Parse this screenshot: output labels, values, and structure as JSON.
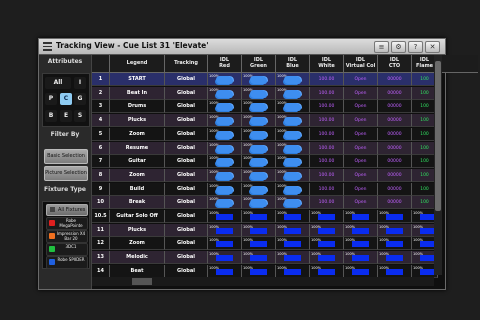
{
  "window": {
    "title": "Tracking View - Cue List 31 'Elevate'"
  },
  "titlebar_buttons": [
    "≡",
    "⚙",
    "?",
    "✕"
  ],
  "sidebar": {
    "attributes_label": "Attributes",
    "attr_buttons": [
      "All",
      "I",
      "P",
      "C",
      "G",
      "B",
      "E",
      "S"
    ],
    "selected_attr": "C",
    "filter_label": "Filter By",
    "filter_buttons": [
      "Basic Selection",
      "Picture Selection"
    ],
    "fixture_type_label": "Fixture Type",
    "all_fixtures_label": "All Fixtures",
    "fixtures": [
      {
        "name": "Robe MegaPointe",
        "color": "#e02020"
      },
      {
        "name": "Impression X4 Bar 20",
        "color": "#f07020"
      },
      {
        "name": "3DC1",
        "color": "#20c040"
      },
      {
        "name": "Robe SPIIDER",
        "color": "#2060e0"
      }
    ]
  },
  "columns": [
    {
      "label": ""
    },
    {
      "label": "Legend"
    },
    {
      "label": "Tracking"
    },
    {
      "label": "IDL\nRed"
    },
    {
      "label": "IDL\nGreen"
    },
    {
      "label": "IDL\nBlue"
    },
    {
      "label": "IDL\nWhite"
    },
    {
      "label": "IDL\nVirtual Col"
    },
    {
      "label": "IDL\nCTO"
    },
    {
      "label": "IDL\nFlame"
    }
  ],
  "rows": [
    {
      "num": "1",
      "legend": "START",
      "tracking": "Global",
      "style": "cloud",
      "white": "100.00",
      "virt": "Open",
      "cto": "00000",
      "flame": "100"
    },
    {
      "num": "2",
      "legend": "Beat In",
      "tracking": "Global",
      "style": "cloud",
      "white": "100.00",
      "virt": "Open",
      "cto": "00000",
      "flame": "100"
    },
    {
      "num": "3",
      "legend": "Drums",
      "tracking": "Global",
      "style": "cloud",
      "white": "100.00",
      "virt": "Open",
      "cto": "00000",
      "flame": "100"
    },
    {
      "num": "4",
      "legend": "Plucks",
      "tracking": "Global",
      "style": "cloud",
      "white": "100.00",
      "virt": "Open",
      "cto": "00000",
      "flame": "100"
    },
    {
      "num": "5",
      "legend": "Zoom",
      "tracking": "Global",
      "style": "cloud",
      "white": "100.00",
      "virt": "Open",
      "cto": "00000",
      "flame": "100"
    },
    {
      "num": "6",
      "legend": "Resume",
      "tracking": "Global",
      "style": "cloud",
      "white": "100.00",
      "virt": "Open",
      "cto": "00000",
      "flame": "100"
    },
    {
      "num": "7",
      "legend": "Guitar",
      "tracking": "Global",
      "style": "cloud",
      "white": "100.00",
      "virt": "Open",
      "cto": "00000",
      "flame": "100"
    },
    {
      "num": "8",
      "legend": "Zoom",
      "tracking": "Global",
      "style": "cloud",
      "white": "100.00",
      "virt": "Open",
      "cto": "00000",
      "flame": "100"
    },
    {
      "num": "9",
      "legend": "Build",
      "tracking": "Global",
      "style": "cloud",
      "white": "100.00",
      "virt": "Open",
      "cto": "00000",
      "flame": "100"
    },
    {
      "num": "10",
      "legend": "Break",
      "tracking": "Global",
      "style": "cloud",
      "white": "100.00",
      "virt": "Open",
      "cto": "00000",
      "flame": "100"
    },
    {
      "num": "10.5",
      "legend": "Guitar Solo Off",
      "tracking": "Global",
      "style": "bar",
      "white": "",
      "virt": "",
      "cto": "",
      "flame": ""
    },
    {
      "num": "11",
      "legend": "Plucks",
      "tracking": "Global",
      "style": "bar",
      "white": "",
      "virt": "",
      "cto": "",
      "flame": ""
    },
    {
      "num": "12",
      "legend": "Zoom",
      "tracking": "Global",
      "style": "bar",
      "white": "",
      "virt": "",
      "cto": "",
      "flame": ""
    },
    {
      "num": "13",
      "legend": "Melodic",
      "tracking": "Global",
      "style": "bar",
      "white": "",
      "virt": "",
      "cto": "",
      "flame": ""
    },
    {
      "num": "14",
      "legend": "Beat",
      "tracking": "Global",
      "style": "bar",
      "white": "",
      "virt": "",
      "cto": "",
      "flame": ""
    }
  ],
  "level_label": "100%",
  "colors": {
    "selected_row": "#2a2f6a",
    "row_even": "#141414",
    "row_odd": "#2e2432",
    "value_purple": "#c060ff",
    "value_green": "#30e060",
    "cloud_blue": "#3e8ef0",
    "bar_blue": "#0a2cf0"
  }
}
